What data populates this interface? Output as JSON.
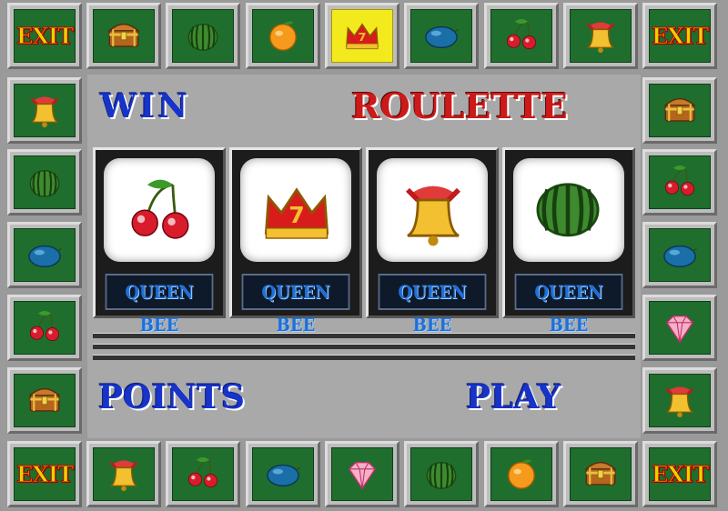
{
  "labels": {
    "win": "WIN",
    "roulette": "ROULETTE",
    "points": "POINTS",
    "play": "PLAY",
    "exit": "EXIT"
  },
  "reels": [
    {
      "symbol": "cherries-icon",
      "name": "QUEEN BEE"
    },
    {
      "symbol": "crown-seven-icon",
      "name": "QUEEN BEE"
    },
    {
      "symbol": "bell-icon",
      "name": "QUEEN BEE"
    },
    {
      "symbol": "watermelon-icon",
      "name": "QUEEN BEE"
    }
  ],
  "roulette_ring": {
    "top": [
      "exit",
      "chest",
      "watermelon",
      "orange",
      "crown",
      "plum",
      "cherries",
      "bell",
      "exit"
    ],
    "left": [
      "bell",
      "watermelon",
      "plum",
      "cherries",
      "chest"
    ],
    "right": [
      "chest",
      "cherries",
      "plum",
      "diamond",
      "bell"
    ],
    "bottom": [
      "exit",
      "bell",
      "cherries",
      "plum",
      "diamond",
      "watermelon",
      "orange",
      "chest",
      "exit"
    ],
    "highlighted": "top-crown"
  },
  "colors": {
    "tile_green": "#1f6e2e",
    "highlight_yellow": "#f2ea1c",
    "label_blue": "#1733c8",
    "label_red": "#cc1a1a",
    "exit_yellow": "#e8d200"
  }
}
